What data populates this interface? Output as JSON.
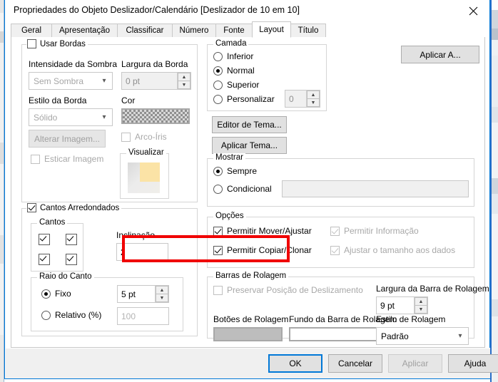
{
  "window": {
    "title": "Propriedades do Objeto Deslizador/Calendário [Deslizador de 10 em 10]",
    "close_icon": "close-icon"
  },
  "tabs": [
    {
      "label": "Geral",
      "selected": false
    },
    {
      "label": "Apresentação",
      "selected": false
    },
    {
      "label": "Classificar",
      "selected": false
    },
    {
      "label": "Número",
      "selected": false
    },
    {
      "label": "Fonte",
      "selected": false
    },
    {
      "label": "Layout",
      "selected": true
    },
    {
      "label": "Título",
      "selected": false
    }
  ],
  "borders_group": {
    "legend": "Usar Bordas",
    "legend_checked": false,
    "shadow_intensity_label": "Intensidade da Sombra",
    "shadow_intensity_value": "Sem Sombra",
    "border_width_label": "Largura da Borda",
    "border_width_value": "0 pt",
    "border_style_label": "Estilo da Borda",
    "border_style_value": "Sólido",
    "color_label": "Cor",
    "color_swatch": "checkerboard-transparent",
    "rainbow_label": "Arco-Íris",
    "rainbow_checked": false,
    "change_image_button": "Alterar Imagem...",
    "stretch_image_label": "Esticar Imagem",
    "stretch_image_checked": false,
    "preview_label": "Visualizar"
  },
  "rounded_group": {
    "legend": "Cantos Arredondados",
    "legend_checked": true,
    "corners_legend": "Cantos",
    "corners": [
      {
        "name": "top-left",
        "checked": true
      },
      {
        "name": "top-right",
        "checked": true
      },
      {
        "name": "bottom-left",
        "checked": true
      },
      {
        "name": "bottom-right",
        "checked": true
      }
    ],
    "slope_label": "Inclinação",
    "slope_value": "2",
    "radius_legend": "Raio do Canto",
    "fixed_label": "Fixo",
    "fixed_selected": true,
    "fixed_value": "5 pt",
    "relative_label": "Relativo (%)",
    "relative_selected": false,
    "relative_value": "100"
  },
  "layer_group": {
    "legend": "Camada",
    "options": [
      {
        "label": "Inferior",
        "selected": false
      },
      {
        "label": "Normal",
        "selected": true
      },
      {
        "label": "Superior",
        "selected": false
      },
      {
        "label": "Personalizar",
        "selected": false
      }
    ],
    "custom_value": "0"
  },
  "theme_buttons": {
    "apply_to": "Aplicar A...",
    "theme_editor": "Editor de Tema...",
    "apply_theme": "Aplicar Tema..."
  },
  "show_group": {
    "legend": "Mostrar",
    "always_label": "Sempre",
    "always_selected": true,
    "conditional_label": "Condicional",
    "conditional_selected": false,
    "conditional_value": ""
  },
  "options_group": {
    "legend": "Opções",
    "allow_move_resize": {
      "label": "Permitir Mover/Ajustar",
      "checked": true,
      "enabled": true
    },
    "allow_copy_clone": {
      "label": "Permitir Copiar/Clonar",
      "checked": true,
      "enabled": true
    },
    "allow_info": {
      "label": "Permitir Informação",
      "checked": true,
      "enabled": false
    },
    "fit_size_to_data": {
      "label": "Ajustar o tamanho aos dados",
      "checked": true,
      "enabled": false,
      "highlighted": true
    }
  },
  "scrollbars_group": {
    "legend": "Barras de Rolagem",
    "preserve_scroll_label": "Preservar Posição de Deslizamento",
    "preserve_scroll_checked": false,
    "scrollbar_width_label": "Largura da Barra de Rolagem",
    "scrollbar_width_value": "9 pt",
    "scroll_buttons_label": "Botões de Rolagem",
    "scroll_buttons_swatch": "gray",
    "scrollbar_background_label": "Fundo da Barra de Rolagem",
    "scrollbar_background_swatch": "white",
    "scroll_style_label": "Estilo de Rolagem",
    "scroll_style_value": "Padrão"
  },
  "footer": {
    "ok": "OK",
    "cancel": "Cancelar",
    "apply": "Aplicar",
    "help": "Ajuda"
  },
  "colors": {
    "accent": "#0078d7",
    "highlight": "#f00000",
    "dialog_bg": "#ffffff",
    "footer_bg": "#f0f0f0"
  }
}
